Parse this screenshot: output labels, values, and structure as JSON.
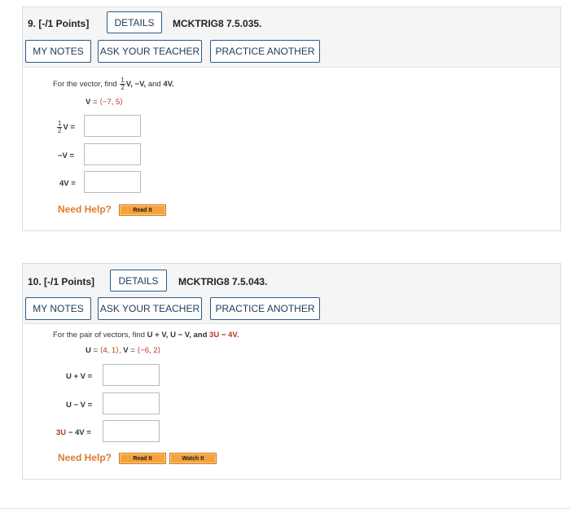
{
  "q9": {
    "number": "9.  [-/1 Points]",
    "details": "DETAILS",
    "code": "MCKTRIG8 7.5.035.",
    "my_notes": "MY NOTES",
    "ask_teacher": "ASK YOUR TEACHER",
    "practice": "PRACTICE ANOTHER",
    "prompt_pre": "For the vector, find",
    "prompt_v1": "V,",
    "prompt_mid": "−V,",
    "prompt_and": "and",
    "prompt_4v": "4V.",
    "frac_num": "1",
    "frac_den": "2",
    "given_lhs": "V",
    "given_eq": "=",
    "given_val": "⟨−7, 5⟩",
    "label_half": "V  =",
    "label_neg": "−V  =",
    "label_4v": "4V  =",
    "need_help": "Need Help?",
    "read_it": "Read It"
  },
  "q10": {
    "number": "10.  [-/1 Points]",
    "details": "DETAILS",
    "code": "MCKTRIG8 7.5.043.",
    "my_notes": "MY NOTES",
    "ask_teacher": "ASK YOUR TEACHER",
    "practice": "PRACTICE ANOTHER",
    "prompt_pre": "For the pair of vectors, find",
    "prompt_tail": "U + V,  U − V,  and",
    "prompt_3u": "3U",
    "prompt_minus": "−",
    "prompt_4v": "4V.",
    "given_u": "U",
    "given_uval": "⟨4, 1⟩,",
    "given_v": "V",
    "given_vval": "⟨−6, 2⟩",
    "eq": "=",
    "label_sum": "U + V  =",
    "label_diff": "U − V  =",
    "label_3u": "3U",
    "label_rest": "−  4V  =",
    "need_help": "Need Help?",
    "read_it": "Read It",
    "watch_it": "Watch It"
  }
}
